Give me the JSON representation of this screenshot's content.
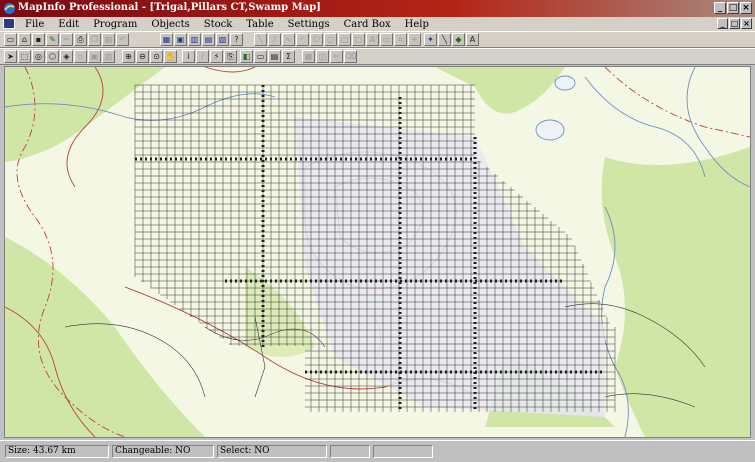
{
  "window": {
    "title": "MapInfo Professional - [Trigal,Pillars CT,Swamp Map]",
    "controls": [
      "_",
      "□",
      "×"
    ]
  },
  "menu": {
    "items": [
      "File",
      "Edit",
      "Program",
      "Objects",
      "Stock",
      "Table",
      "Settings",
      "Card Box",
      "Help"
    ]
  },
  "toolbar1": {
    "buttons": [
      "new-icon",
      "open-icon",
      "save-icon",
      "save-workspace-icon",
      "print-icon",
      "cut-icon",
      "copy-icon",
      "paste-icon",
      "undo-icon",
      "browser-icon",
      "mapper-icon",
      "graph-icon",
      "layout-icon",
      "help-icon",
      "draw-icon",
      "line-icon",
      "polyline-icon",
      "arc-icon",
      "polygon-icon",
      "ellipse-icon",
      "rectangle-icon",
      "rounded-rect-icon",
      "text-icon",
      "frame-icon",
      "reshape-icon",
      "add-node-icon",
      "symbol-style-icon",
      "line-style-icon",
      "region-style-icon",
      "text-style-icon"
    ]
  },
  "toolbar2": {
    "buttons": [
      "select-arrow-icon",
      "marquee-select-icon",
      "radius-select-icon",
      "polygon-select-icon",
      "boundary-select-icon",
      "unselect-icon",
      "invert-select-icon",
      "graph-select-icon",
      "zoom-in-icon",
      "zoom-out-icon",
      "change-view-icon",
      "grabber-icon",
      "info-icon",
      "label-icon",
      "drag-window-icon",
      "hotlink-icon",
      "layer-control-icon",
      "ruler-icon",
      "legend-icon",
      "statistics-icon",
      "clip-region-icon",
      "set-target-icon",
      "reshape-split-icon",
      "erase-icon"
    ]
  },
  "map": {
    "name": "Trigal,Pillars CT,Swamp Map",
    "colors": {
      "background": "#f4f7e4",
      "vegetation": "#cfe6a6",
      "water": "#6f8fbf",
      "contour": "#c04040",
      "pillar_grid": "#202020",
      "swamp": "#e4e4ee"
    }
  },
  "status": {
    "size": "Size: 43.67 km",
    "changeable": "Changeable: NO",
    "select": "Select: NO"
  }
}
